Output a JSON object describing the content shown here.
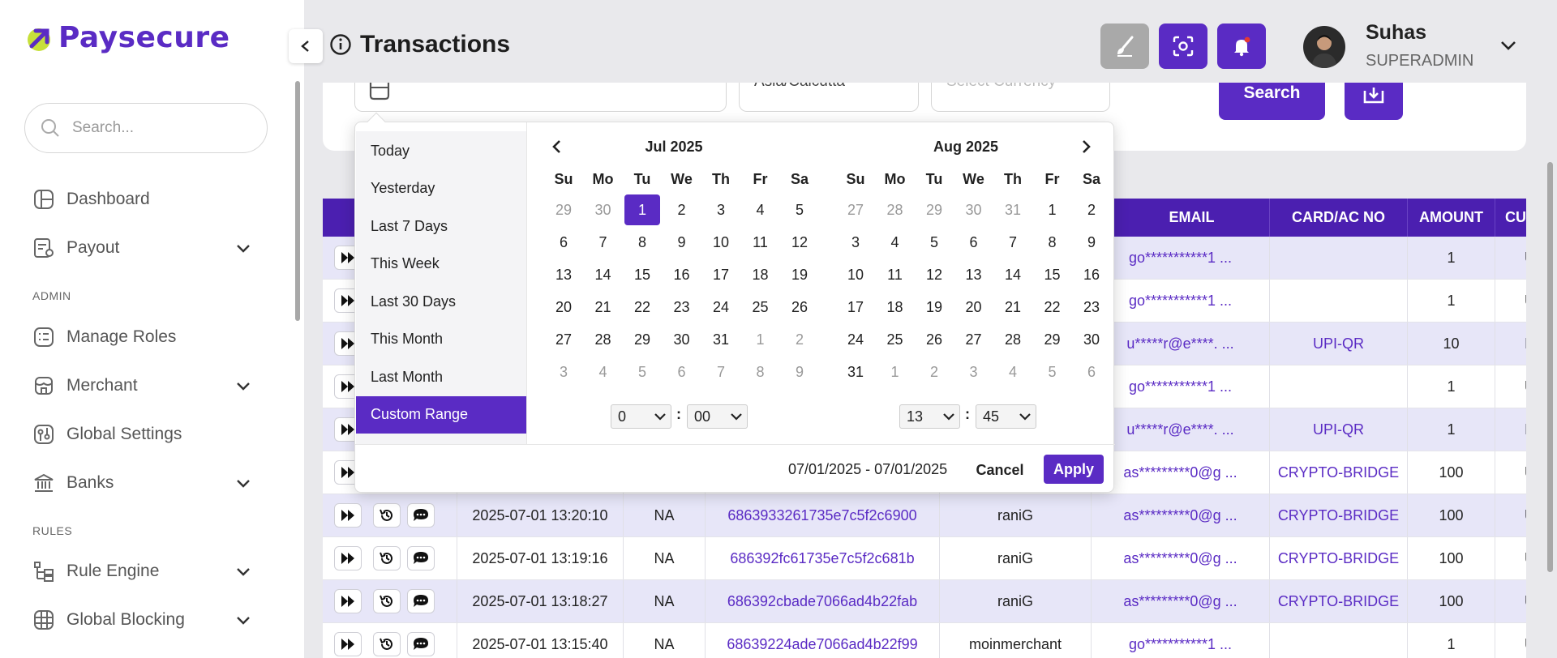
{
  "brand": {
    "name": "Paysecure",
    "accent": "#5a2bc4",
    "logo_accent": "#c7e03a"
  },
  "sidebar": {
    "search_placeholder": "Search...",
    "sections": {
      "admin": "ADMIN",
      "rules": "RULES"
    },
    "items": [
      {
        "label": "Dashboard",
        "icon": "dashboard-icon",
        "has_chevron": false
      },
      {
        "label": "Payout",
        "icon": "payout-icon",
        "has_chevron": true
      },
      {
        "label": "Manage Roles",
        "icon": "roles-icon",
        "has_chevron": false
      },
      {
        "label": "Merchant",
        "icon": "merchant-icon",
        "has_chevron": true
      },
      {
        "label": "Global Settings",
        "icon": "settings-icon",
        "has_chevron": false
      },
      {
        "label": "Banks",
        "icon": "bank-icon",
        "has_chevron": true
      },
      {
        "label": "Rule Engine",
        "icon": "rule-engine-icon",
        "has_chevron": true
      },
      {
        "label": "Global Blocking",
        "icon": "blocking-icon",
        "has_chevron": true
      }
    ]
  },
  "header": {
    "title": "Transactions",
    "user": {
      "name": "Suhas",
      "role": "SUPERADMIN"
    }
  },
  "filters": {
    "timezone": "Asia/Calcutta",
    "currency_placeholder": "Select Currency",
    "search_label": "Search"
  },
  "datepicker": {
    "ranges": [
      "Today",
      "Yesterday",
      "Last 7 Days",
      "This Week",
      "Last 30 Days",
      "This Month",
      "Last Month",
      "Custom Range"
    ],
    "active_range": "Custom Range",
    "weekdays": [
      "Su",
      "Mo",
      "Tu",
      "We",
      "Th",
      "Fr",
      "Sa"
    ],
    "left": {
      "month": "Jul 2025",
      "weeks": [
        [
          "29",
          "30",
          "1",
          "2",
          "3",
          "4",
          "5"
        ],
        [
          "6",
          "7",
          "8",
          "9",
          "10",
          "11",
          "12"
        ],
        [
          "13",
          "14",
          "15",
          "16",
          "17",
          "18",
          "19"
        ],
        [
          "20",
          "21",
          "22",
          "23",
          "24",
          "25",
          "26"
        ],
        [
          "27",
          "28",
          "29",
          "30",
          "31",
          "1",
          "2"
        ],
        [
          "3",
          "4",
          "5",
          "6",
          "7",
          "8",
          "9"
        ]
      ],
      "selected": "1",
      "time_hour": "0",
      "time_min": "00"
    },
    "right": {
      "month": "Aug 2025",
      "weeks": [
        [
          "27",
          "28",
          "29",
          "30",
          "31",
          "1",
          "2"
        ],
        [
          "3",
          "4",
          "5",
          "6",
          "7",
          "8",
          "9"
        ],
        [
          "10",
          "11",
          "12",
          "13",
          "14",
          "15",
          "16"
        ],
        [
          "17",
          "18",
          "19",
          "20",
          "21",
          "22",
          "23"
        ],
        [
          "24",
          "25",
          "26",
          "27",
          "28",
          "29",
          "30"
        ],
        [
          "31",
          "1",
          "2",
          "3",
          "4",
          "5",
          "6"
        ]
      ],
      "time_hour": "13",
      "time_min": "45"
    },
    "range_text": "07/01/2025 - 07/01/2025",
    "cancel_label": "Cancel",
    "apply_label": "Apply"
  },
  "table": {
    "columns": [
      "",
      "",
      "",
      "",
      "",
      "EMAIL",
      "CARD/AC NO",
      "AMOUNT",
      "CURRE"
    ],
    "rows": [
      {
        "date": "",
        "na": "",
        "id": "",
        "merchant": "",
        "email": "go***********1 ...",
        "card": "",
        "amount": "1",
        "cur": "US"
      },
      {
        "date": "",
        "na": "",
        "id": "",
        "merchant": "",
        "email": "go***********1 ...",
        "card": "",
        "amount": "1",
        "cur": "US"
      },
      {
        "date": "",
        "na": "",
        "id": "",
        "merchant": "",
        "email": "u*****r@e****. ...",
        "card": "UPI-QR",
        "amount": "10",
        "cur": "INI"
      },
      {
        "date": "",
        "na": "",
        "id": "",
        "merchant": "",
        "email": "go***********1 ...",
        "card": "",
        "amount": "1",
        "cur": "US"
      },
      {
        "date": "",
        "na": "",
        "id": "",
        "merchant": "",
        "email": "u*****r@e****. ...",
        "card": "UPI-QR",
        "amount": "1",
        "cur": "INI"
      },
      {
        "date": "",
        "na": "",
        "id": "",
        "merchant": "",
        "email": "as*********0@g ...",
        "card": "CRYPTO-BRIDGE",
        "amount": "100",
        "cur": "US"
      },
      {
        "date": "2025-07-01 13:20:10",
        "na": "NA",
        "id": "6863933261735e7c5f2c6900",
        "merchant": "raniG",
        "email": "as*********0@g ...",
        "card": "CRYPTO-BRIDGE",
        "amount": "100",
        "cur": "US"
      },
      {
        "date": "2025-07-01 13:19:16",
        "na": "NA",
        "id": "686392fc61735e7c5f2c681b",
        "merchant": "raniG",
        "email": "as*********0@g ...",
        "card": "CRYPTO-BRIDGE",
        "amount": "100",
        "cur": "US"
      },
      {
        "date": "2025-07-01 13:18:27",
        "na": "NA",
        "id": "686392cbade7066ad4b22fab",
        "merchant": "raniG",
        "email": "as*********0@g ...",
        "card": "CRYPTO-BRIDGE",
        "amount": "100",
        "cur": "US"
      },
      {
        "date": "2025-07-01 13:15:40",
        "na": "NA",
        "id": "68639224ade7066ad4b22f99",
        "merchant": "moinmerchant",
        "email": "go***********1 ...",
        "card": "",
        "amount": "1",
        "cur": "US"
      }
    ]
  }
}
